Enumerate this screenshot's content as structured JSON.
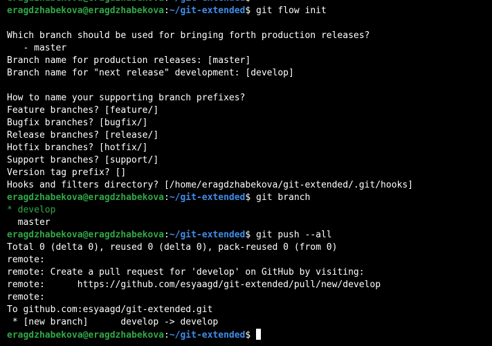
{
  "prompt": {
    "user_host": "eragdzhabekova@eragdzhabekova",
    "sep": ":",
    "path": "~/git-extended",
    "symbol": "$"
  },
  "commands": {
    "top_partial": "",
    "flow_init": "git flow init",
    "branch": "git branch",
    "push": "git push --all"
  },
  "output_init": [
    "",
    "Which branch should be used for bringing forth production releases?",
    "   - master",
    "Branch name for production releases: [master]",
    "Branch name for \"next release\" development: [develop]",
    "",
    "How to name your supporting branch prefixes?",
    "Feature branches? [feature/]",
    "Bugfix branches? [bugfix/]",
    "Release branches? [release/]",
    "Hotfix branches? [hotfix/]",
    "Support branches? [support/]",
    "Version tag prefix? []",
    "Hooks and filters directory? [/home/eragdzhabekova/git-extended/.git/hooks]"
  ],
  "branch_output": {
    "current": "* develop",
    "other": "  master"
  },
  "output_push": [
    "Total 0 (delta 0), reused 0 (delta 0), pack-reused 0 (from 0)",
    "remote: ",
    "remote: Create a pull request for 'develop' on GitHub by visiting:",
    "remote:      https://github.com/esyaagd/git-extended/pull/new/develop",
    "remote: ",
    "To github.com:esyaagd/git-extended.git",
    " * [new branch]      develop -> develop"
  ],
  "colors": {
    "background": "#000000",
    "text": "#ffffff",
    "prompt_user": "#31a848",
    "prompt_path": "#3f8ee9",
    "current_branch": "#31a848"
  }
}
